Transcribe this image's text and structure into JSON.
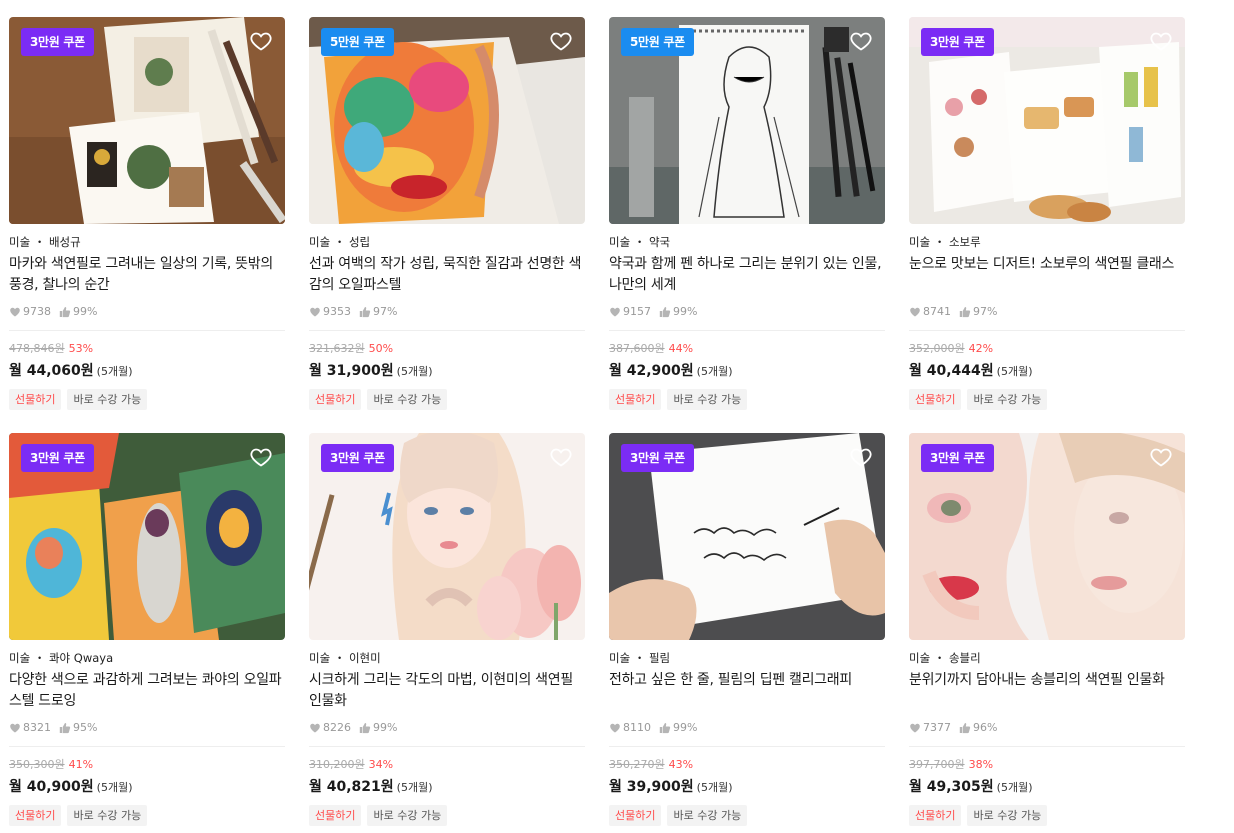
{
  "colors": {
    "coupon_purple": "#7b2cf5",
    "coupon_blue": "#1a8cf0",
    "discount_red": "#ff4b4b"
  },
  "icons": {
    "heart": "heart-outline-icon",
    "likes": "heart-filled-icon",
    "thumbs": "thumbs-up-icon"
  },
  "cards": [
    {
      "coupon": "3만원 쿠폰",
      "coupon_color": "#7b2cf5",
      "category": "미술 ・ 배성규",
      "title": "마카와 색연필로 그려내는 일상의 기록, 뜻밖의 풍경, 찰나의 순간",
      "likes": "9738",
      "rating": "99%",
      "original_price": "478,846원",
      "discount": "53%",
      "monthly_price": "월 44,060원",
      "months": "(5개월)",
      "gift_label": "선물하기",
      "status_label": "바로 수강 가능"
    },
    {
      "coupon": "5만원 쿠폰",
      "coupon_color": "#1a8cf0",
      "category": "미술 ・ 성립",
      "title": "선과 여백의 작가 성립, 묵직한 질감과 선명한 색감의 오일파스텔",
      "likes": "9353",
      "rating": "97%",
      "original_price": "321,632원",
      "discount": "50%",
      "monthly_price": "월 31,900원",
      "months": "(5개월)",
      "gift_label": "선물하기",
      "status_label": "바로 수강 가능"
    },
    {
      "coupon": "5만원 쿠폰",
      "coupon_color": "#1a8cf0",
      "category": "미술 ・ 약국",
      "title": "약국과 함께 펜 하나로 그리는 분위기 있는 인물, 나만의 세계",
      "likes": "9157",
      "rating": "99%",
      "original_price": "387,600원",
      "discount": "44%",
      "monthly_price": "월 42,900원",
      "months": "(5개월)",
      "gift_label": "선물하기",
      "status_label": "바로 수강 가능"
    },
    {
      "coupon": "3만원 쿠폰",
      "coupon_color": "#7b2cf5",
      "category": "미술 ・ 소보루",
      "title": "눈으로 맛보는 디저트! 소보루의 색연필 클래스",
      "likes": "8741",
      "rating": "97%",
      "original_price": "352,000원",
      "discount": "42%",
      "monthly_price": "월 40,444원",
      "months": "(5개월)",
      "gift_label": "선물하기",
      "status_label": "바로 수강 가능"
    },
    {
      "coupon": "3만원 쿠폰",
      "coupon_color": "#7b2cf5",
      "category": "미술 ・ 콰야 Qwaya",
      "title": "다양한 색으로 과감하게 그려보는 콰야의 오일파스텔 드로잉",
      "likes": "8321",
      "rating": "95%",
      "original_price": "350,300원",
      "discount": "41%",
      "monthly_price": "월 40,900원",
      "months": "(5개월)",
      "gift_label": "선물하기",
      "status_label": "바로 수강 가능"
    },
    {
      "coupon": "3만원 쿠폰",
      "coupon_color": "#7b2cf5",
      "category": "미술 ・ 이현미",
      "title": "시크하게 그리는 각도의 마법, 이현미의 색연필 인물화",
      "likes": "8226",
      "rating": "99%",
      "original_price": "310,200원",
      "discount": "34%",
      "monthly_price": "월 40,821원",
      "months": "(5개월)",
      "gift_label": "선물하기",
      "status_label": "바로 수강 가능"
    },
    {
      "coupon": "3만원 쿠폰",
      "coupon_color": "#7b2cf5",
      "category": "미술 ・ 필림",
      "title": "전하고 싶은 한 줄, 필림의 딥펜 캘리그래피",
      "likes": "8110",
      "rating": "99%",
      "original_price": "350,270원",
      "discount": "43%",
      "monthly_price": "월 39,900원",
      "months": "(5개월)",
      "gift_label": "선물하기",
      "status_label": "바로 수강 가능"
    },
    {
      "coupon": "3만원 쿠폰",
      "coupon_color": "#7b2cf5",
      "category": "미술 ・ 송블리",
      "title": "분위기까지 담아내는 송블리의 색연필 인물화",
      "likes": "7377",
      "rating": "96%",
      "original_price": "397,700원",
      "discount": "38%",
      "monthly_price": "월 49,305원",
      "months": "(5개월)",
      "gift_label": "선물하기",
      "status_label": "바로 수강 가능"
    }
  ]
}
